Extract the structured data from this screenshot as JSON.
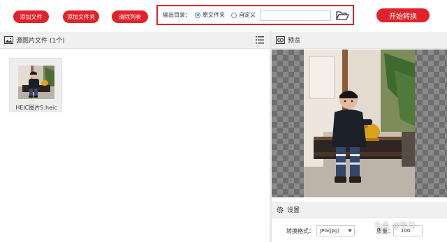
{
  "toolbar": {
    "add_file_label": "添加文件",
    "add_folder_label": "添加文件夹",
    "clear_list_label": "清除列表",
    "convert_label": "开始转换"
  },
  "output": {
    "label": "输出目录：",
    "option_source": "原文件夹",
    "option_custom": "自定义",
    "selected": "原文件夹",
    "path_value": ""
  },
  "source_panel": {
    "title": "源图片文件 (1个)",
    "files": [
      {
        "name": "HEIC图片5.heic"
      }
    ]
  },
  "preview_panel": {
    "title": "预览"
  },
  "settings": {
    "title": "设置",
    "format_label": "转换格式：",
    "format_value": "JPG(jpg)",
    "quality_label": "质量：",
    "quality_value": "100"
  },
  "watermark": {
    "text": "头条 @学习"
  },
  "colors": {
    "accent": "#e1222a",
    "radio_selected": "#2d8cf0",
    "panel_header_bg": "#f0f0f0"
  }
}
